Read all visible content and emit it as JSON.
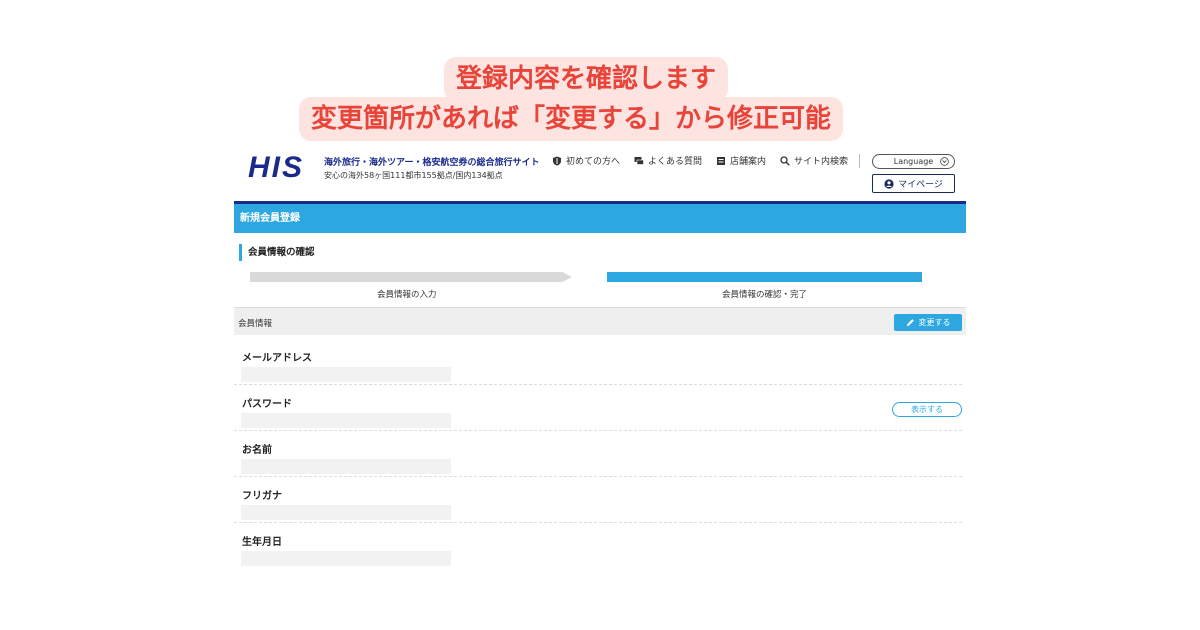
{
  "callout": {
    "line1": "登録内容を確認します",
    "line2": "変更箇所があれば「変更する」から修正可能"
  },
  "header": {
    "logo": "HIS",
    "tagline": "海外旅行・海外ツアー・格安航空券の総合旅行サイト",
    "subtagline": "安心の海外58ヶ国111都市155拠点/国内134拠点",
    "nav": [
      {
        "label": "初めての方へ",
        "icon": "shield-icon"
      },
      {
        "label": "よくある質問",
        "icon": "chat-icon"
      },
      {
        "label": "店舗案内",
        "icon": "store-icon"
      },
      {
        "label": "サイト内検索",
        "icon": "search-icon"
      }
    ],
    "language_label": "Language",
    "mypage_label": "マイページ"
  },
  "page": {
    "title": "新規会員登録",
    "section_heading": "会員情報の確認"
  },
  "steps": [
    {
      "label": "会員情報の入力",
      "status": "done"
    },
    {
      "label": "会員情報の確認・完了",
      "status": "current"
    }
  ],
  "info": {
    "header_label": "会員情報",
    "edit_button": "変更する"
  },
  "fields": [
    {
      "label": "メールアドレス"
    },
    {
      "label": "パスワード",
      "show_button": "表示する"
    },
    {
      "label": "お名前"
    },
    {
      "label": "フリガナ"
    },
    {
      "label": "生年月日"
    }
  ],
  "colors": {
    "accent": "#2da7e0",
    "brand": "#1a2a8c",
    "callout_text": "#e8443a",
    "callout_bg": "#fde4e0"
  }
}
